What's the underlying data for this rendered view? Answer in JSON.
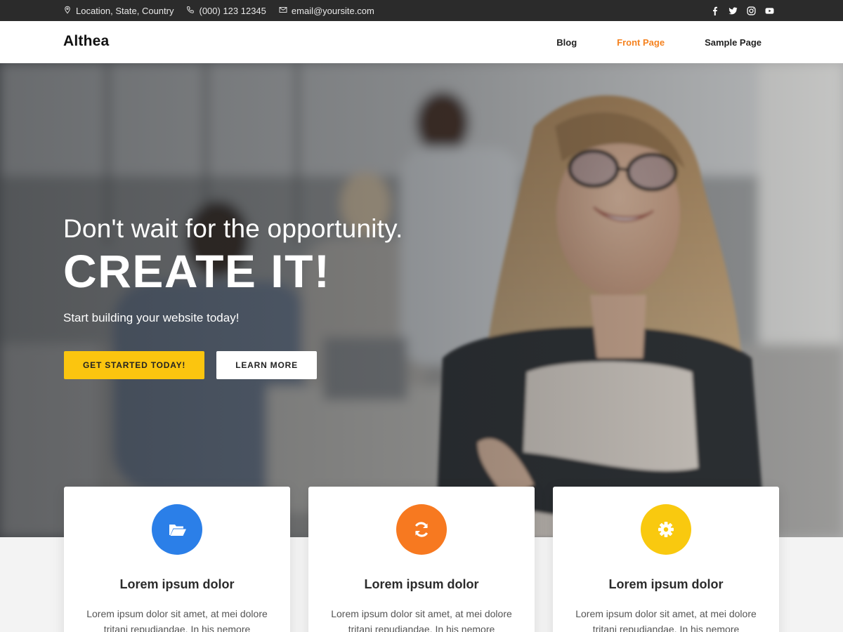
{
  "topbar": {
    "location": "Location, State, Country",
    "phone": "(000) 123 12345",
    "email": "email@yoursite.com",
    "social_icons": [
      "facebook-icon",
      "twitter-icon",
      "instagram-icon",
      "youtube-icon"
    ]
  },
  "header": {
    "logo": "Althea",
    "nav": [
      "Blog",
      "Front Page",
      "Sample Page"
    ],
    "active_nav": "Front Page"
  },
  "hero": {
    "subtitle": "Don't wait for the opportunity.",
    "title": "CREATE IT!",
    "description": "Start building your website today!",
    "primary_button": "GET STARTED TODAY!",
    "secondary_button": "LEARN MORE"
  },
  "features": [
    {
      "icon": "folder-open-icon",
      "color": "#2b7fe8",
      "title": "Lorem ipsum dolor",
      "text": "Lorem ipsum dolor sit amet, at mei dolore tritani repudiandae. In his nemore"
    },
    {
      "icon": "sync-icon",
      "color": "#f77920",
      "title": "Lorem ipsum dolor",
      "text": "Lorem ipsum dolor sit amet, at mei dolore tritani repudiandae. In his nemore"
    },
    {
      "icon": "gear-icon",
      "color": "#f9c90f",
      "title": "Lorem ipsum dolor",
      "text": "Lorem ipsum dolor sit amet, at mei dolore tritani repudiandae. In his nemore"
    }
  ],
  "colors": {
    "accent": "#f5821f",
    "primary_button": "#fbc50f",
    "topbar_bg": "#2b2b2b"
  }
}
